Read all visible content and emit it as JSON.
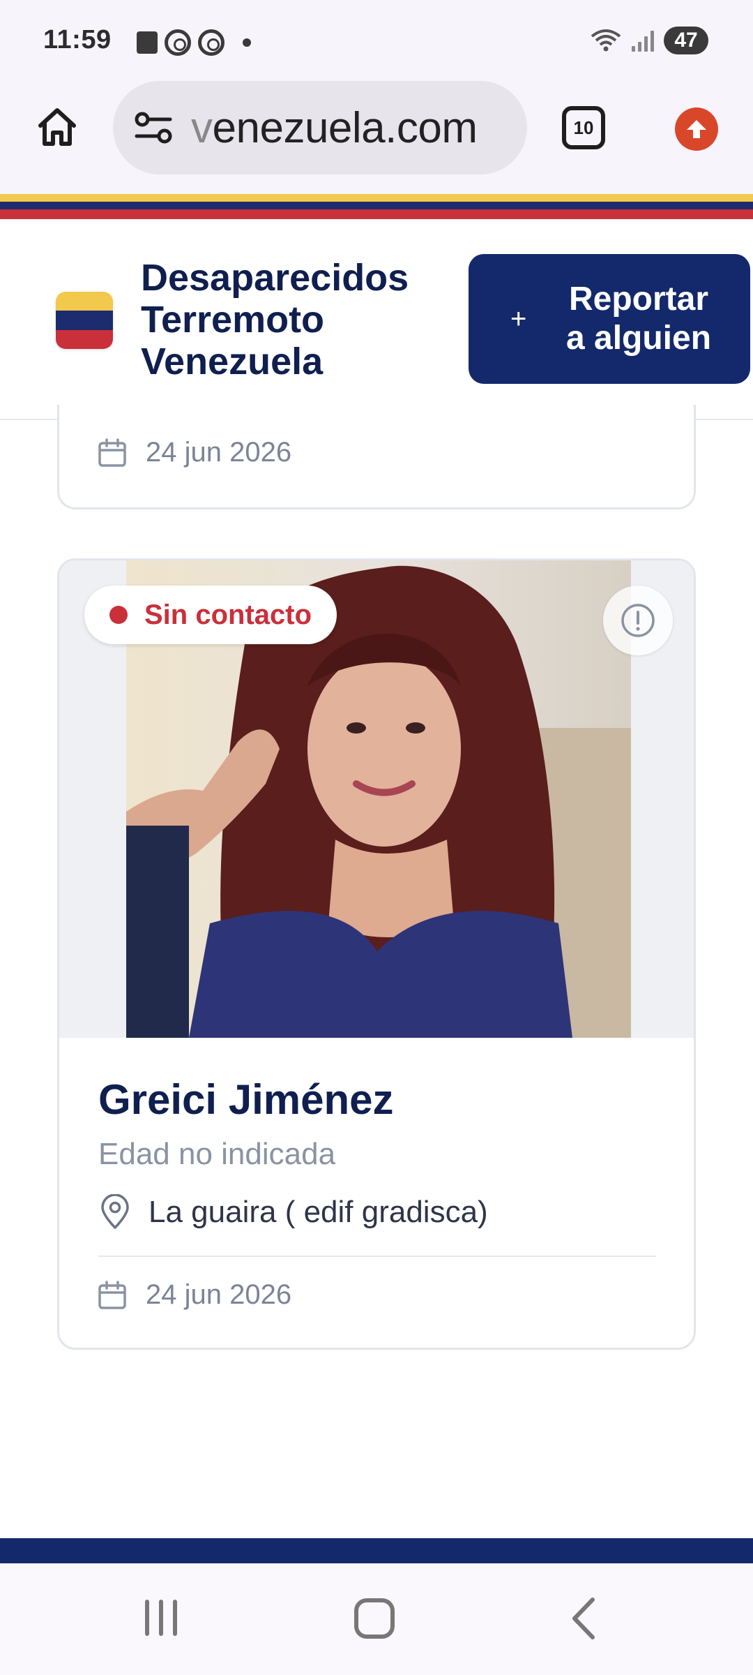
{
  "status_bar": {
    "time": "11:59",
    "left_icons": [
      "notification-square-icon",
      "whatsapp-icon",
      "whatsapp-icon",
      "more-notifications-dot-icon"
    ],
    "right_icons": [
      "wifi-icon",
      "signal-icon"
    ],
    "battery": "47"
  },
  "browser": {
    "url_fade": "v",
    "url": "enezuela.com",
    "tab_count": "10",
    "icons": [
      "home-icon",
      "site-settings-icon",
      "tabs-icon",
      "menu-update-icon"
    ]
  },
  "site": {
    "title_lines": [
      "Desaparecidos",
      "Terremoto",
      "Venezuela"
    ],
    "report_button": {
      "plus": "+",
      "lines": [
        "Reportar",
        "a alguien"
      ]
    },
    "colors": {
      "yellow": "#f2c94c",
      "blue": "#1c2c6e",
      "red": "#c9303a",
      "navy": "#13296b"
    }
  },
  "previous_card": {
    "date": "24 jun 2026"
  },
  "card": {
    "status": "Sin contacto",
    "name": "Greici Jiménez",
    "age": "Edad no indicada",
    "location": "La guaira ( edif gradisca)",
    "date": "24 jun 2026"
  },
  "nav": {
    "icons": [
      "recents-icon",
      "home-icon",
      "back-icon"
    ]
  }
}
